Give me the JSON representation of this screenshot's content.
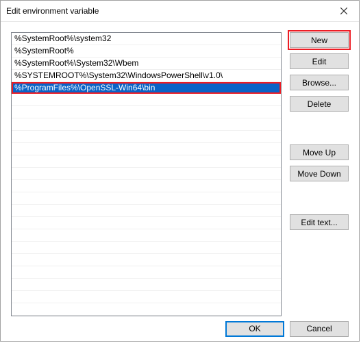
{
  "window": {
    "title": "Edit environment variable"
  },
  "list": {
    "items": [
      {
        "text": "%SystemRoot%\\system32",
        "selected": false,
        "highlighted": false
      },
      {
        "text": "%SystemRoot%",
        "selected": false,
        "highlighted": false
      },
      {
        "text": "%SystemRoot%\\System32\\Wbem",
        "selected": false,
        "highlighted": false
      },
      {
        "text": "%SYSTEMROOT%\\System32\\WindowsPowerShell\\v1.0\\",
        "selected": false,
        "highlighted": false
      },
      {
        "text": "%ProgramFiles%\\OpenSSL-Win64\\bin",
        "selected": true,
        "highlighted": true
      }
    ],
    "blank_rows": 18
  },
  "buttons": {
    "new": "New",
    "edit": "Edit",
    "browse": "Browse...",
    "delete": "Delete",
    "move_up": "Move Up",
    "move_down": "Move Down",
    "edit_text": "Edit text..."
  },
  "footer": {
    "ok": "OK",
    "cancel": "Cancel"
  },
  "highlights": {
    "new_button": true
  }
}
